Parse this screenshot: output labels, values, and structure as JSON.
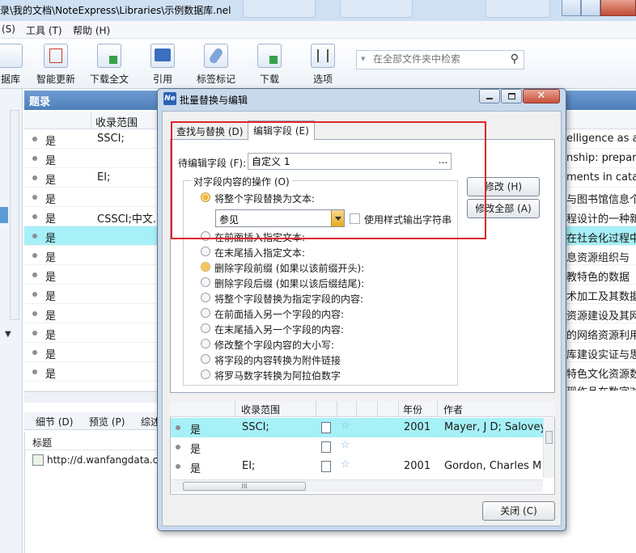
{
  "window": {
    "title": "录\\我的文档\\NoteExpress\\Libraries\\示例数据库.nel"
  },
  "menu": {
    "items": [
      "(S)",
      "工具 (T)",
      "帮助 (H)"
    ]
  },
  "toolbar": {
    "items": [
      {
        "label": "据库",
        "icon": "database-icon"
      },
      {
        "label": "智能更新",
        "icon": "smart-update-icon"
      },
      {
        "label": "下载全文",
        "icon": "download-fulltext-icon"
      },
      {
        "label": "引用",
        "icon": "cite-icon"
      },
      {
        "label": "标签标记",
        "icon": "tag-icon"
      },
      {
        "label": "下载",
        "icon": "download-icon"
      },
      {
        "label": "选项",
        "icon": "options-icon"
      }
    ],
    "search_placeholder": "在全部文件夹中检索"
  },
  "list": {
    "header": "题录",
    "col_source": "收录范围",
    "rows": [
      {
        "flag": "是",
        "source": "SSCI;",
        "title": "elligence as a s"
      },
      {
        "flag": "是",
        "source": "",
        "title": "nship: preparii"
      },
      {
        "flag": "是",
        "source": "EI;",
        "title": "ments in catalyt"
      },
      {
        "flag": "是",
        "source": "",
        "title": "与图书馆信息个"
      },
      {
        "flag": "是",
        "source": "CSSCI;中文...",
        "title": "程设计的一种新"
      },
      {
        "flag": "是",
        "source": "",
        "title": "在社会化过程中"
      },
      {
        "flag": "是",
        "source": "",
        "title": "息资源组织与"
      },
      {
        "flag": "是",
        "source": "",
        "title": "教特色的数据"
      },
      {
        "flag": "是",
        "source": "",
        "title": "术加工及其数据"
      },
      {
        "flag": "是",
        "source": "",
        "title": "资源建设及其网"
      },
      {
        "flag": "是",
        "source": "",
        "title": "的网络资源利用"
      },
      {
        "flag": "是",
        "source": "",
        "title": "库建设实证与思"
      },
      {
        "flag": "是",
        "source": "",
        "title": "特色文化资源数"
      },
      {
        "flag": "",
        "source": "",
        "title": "现作品在数字对"
      }
    ],
    "selected_index": 5
  },
  "detail": {
    "tabs": [
      "细节 (D)",
      "预览 (P)",
      "综述"
    ],
    "field_label": "标题",
    "link_text": "http://d.wanfangdata.co"
  },
  "dialog": {
    "title": "批量替换与编辑",
    "tabs": [
      "查找与替换 (D)",
      "编辑字段 (E)"
    ],
    "active_tab": 1,
    "field_label": "待编辑字段 (F):",
    "field_value": "自定义 1",
    "field_button": "...",
    "group_label": "对字段内容的操作 (O)",
    "options": [
      "将整个字段替换为文本:",
      "在前面插入指定文本:",
      "在末尾插入指定文本:",
      "删除字段前缀 (如果以该前缀开头):",
      "删除字段后缀 (如果以该后缀结尾):",
      "将整个字段替换为指定字段的内容:",
      "在前面插入另一个字段的内容:",
      "在末尾插入另一个字段的内容:",
      "修改整个字段内容的大小写:",
      "将字段的内容转换为附件链接",
      "将罗马数字转换为阿拉伯数字"
    ],
    "selected_option": 0,
    "text_value": "参见",
    "style_checkbox_label": "使用样式输出字符串",
    "style_checked": false,
    "btn_modify": "修改 (H)",
    "btn_modify_all": "修改全部 (A)",
    "btn_close": "关闭 (C)",
    "grid": {
      "headers": [
        "收录范围",
        "年份",
        "作者"
      ],
      "rows": [
        {
          "flag": "是",
          "source": "SSCI;",
          "year": "2001",
          "author": "Mayer, J D; Salovey,"
        },
        {
          "flag": "是",
          "source": "",
          "year": "",
          "author": ""
        },
        {
          "flag": "是",
          "source": "EI;",
          "year": "2001",
          "author": "Gordon, Charles M"
        }
      ],
      "scroll_thumb": "III"
    }
  },
  "colors": {
    "selection": "#a6f0f7",
    "header_blue": "#5b8bc6",
    "highlight_red": "#e0252c"
  }
}
